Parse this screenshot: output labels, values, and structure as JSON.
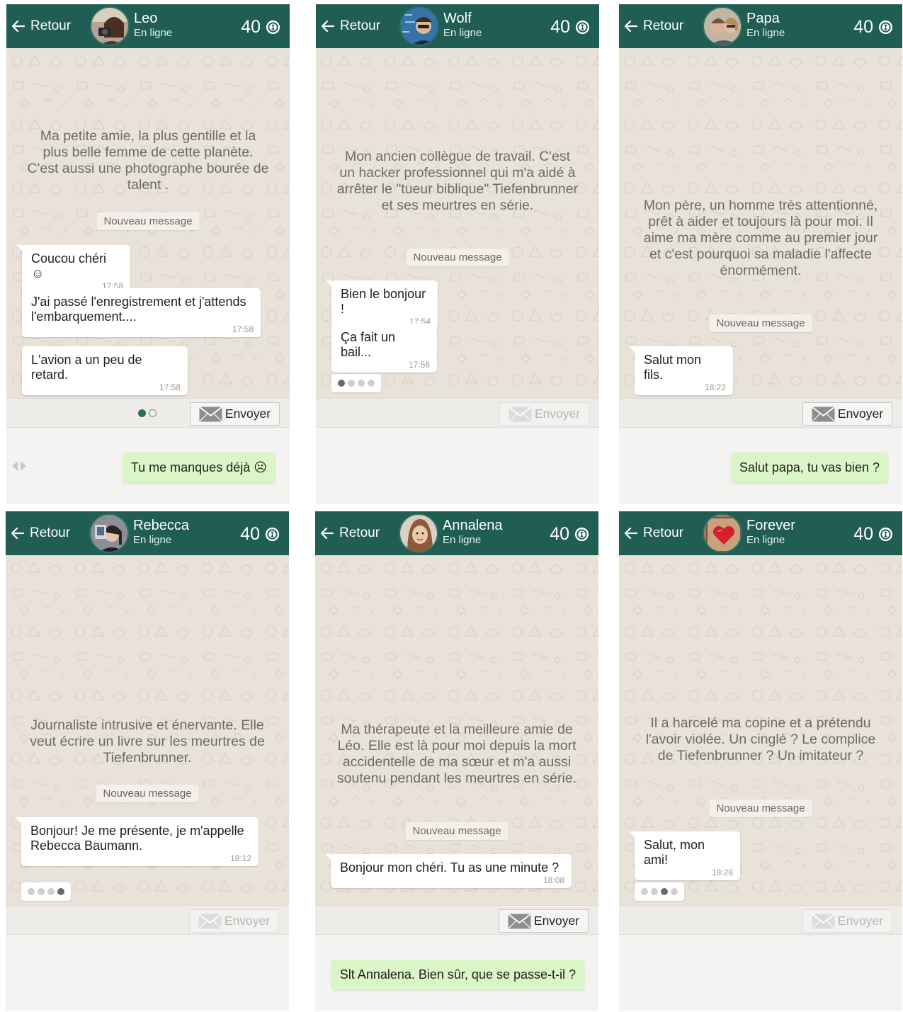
{
  "common": {
    "back_label": "Retour",
    "status": "En ligne",
    "coins": "40",
    "send_label": "Envoyer",
    "new_message": "Nouveau message"
  },
  "panels": [
    {
      "contact": "Leo",
      "description": "Ma petite amie, la plus gentille et la plus belle femme de cette planète. C'est aussi une photographe bourée de talent .",
      "messages": [
        {
          "text": "Coucou chéri ☺",
          "time": "17:58"
        },
        {
          "text": "J'ai passé  l'enregistrement et j'attends l'embarquement....",
          "time": "17:58"
        },
        {
          "text": "L'avion a un peu de retard.",
          "time": "17:58"
        }
      ],
      "reply": "Tu me manques déjà ☹",
      "send_enabled": true
    },
    {
      "contact": "Wolf",
      "description": "Mon ancien collègue de travail. C'est un hacker professionnel qui m'a aidé à arrêter le \"tueur biblique\" Tiefenbrunner et ses meurtres en série.",
      "messages": [
        {
          "text": "Bien le bonjour !",
          "time": "17:54"
        },
        {
          "text": "Ça fait un bail...",
          "time": "17:56"
        }
      ],
      "typing_dots": [
        true,
        false,
        false,
        false
      ],
      "send_enabled": false
    },
    {
      "contact": "Papa",
      "description": "Mon père, un homme très attentionné, prêt à aider et toujours là pour moi. Il aime ma mère comme au  premier jour et c'est pourquoi sa maladie l'affecte énormément.",
      "messages": [
        {
          "text": "Salut mon fils.",
          "time": "18:22"
        }
      ],
      "reply": "Salut papa, tu vas bien ?",
      "send_enabled": true
    },
    {
      "contact": "Rebecca",
      "description": "Journaliste intrusive et énervante. Elle veut écrire un livre sur les meurtres de Tiefenbrunner.",
      "messages": [
        {
          "text": "Bonjour! Je me présente, je m'appelle Rebecca Baumann.",
          "time": "18:12"
        }
      ],
      "typing_dots": [
        false,
        false,
        false,
        true
      ],
      "send_enabled": false
    },
    {
      "contact": "Annalena",
      "description": "Ma thérapeute et la meilleure amie de Léo. Elle est là pour moi depuis la mort accidentelle de ma sœur et m'a aussi soutenu pendant les meurtres en série.",
      "messages": [
        {
          "text": "Bonjour mon chéri. Tu as une minute ?",
          "time": "18:08"
        }
      ],
      "reply": "Slt Annalena. Bien sûr, que se passe-t-il ?",
      "send_enabled": true
    },
    {
      "contact": "Forever",
      "description": "Il a harcelé ma copine et a prétendu l'avoir violée. Un cinglé ? Le complice de Tiefenbrunner ? Un imitateur ?",
      "messages": [
        {
          "text": "Salut, mon ami!",
          "time": "18:28"
        }
      ],
      "typing_dots": [
        false,
        false,
        true,
        false
      ],
      "send_enabled": false
    }
  ],
  "colors": {
    "header": "#205d52",
    "chat_bg": "#e8e2d9",
    "reply_bubble": "#dbf6c6"
  },
  "icons": [
    "back-arrow-icon",
    "coin-icon",
    "envelope-icon",
    "avatar",
    "swipe-arrows-icon",
    "page-indicator"
  ]
}
